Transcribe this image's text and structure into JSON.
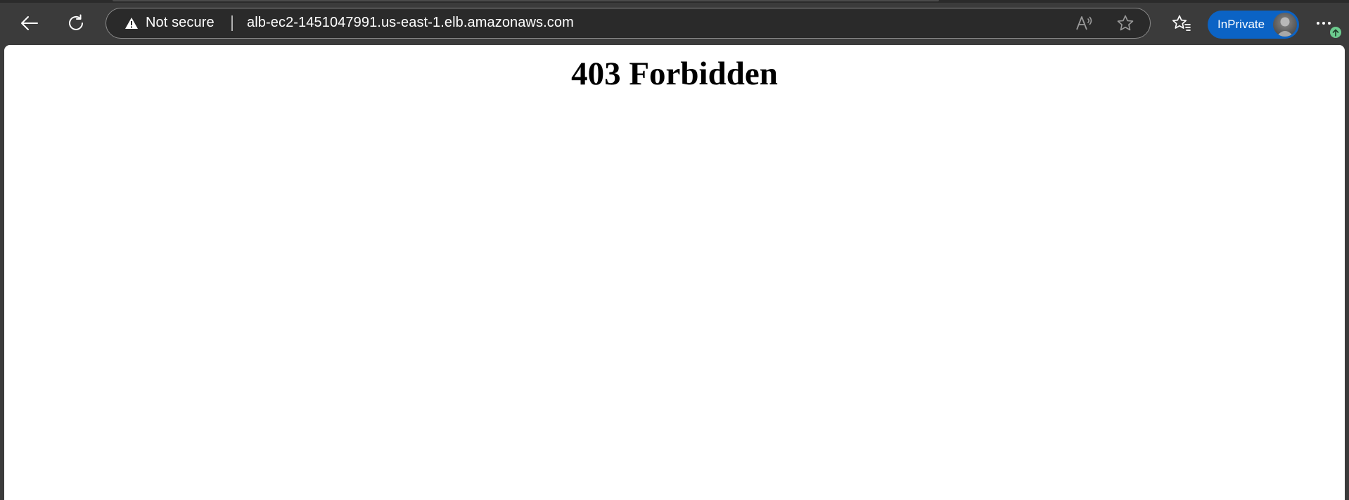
{
  "browser": {
    "address_bar": {
      "security_label": "Not secure",
      "url": "alb-ec2-1451047991.us-east-1.elb.amazonaws.com"
    },
    "profile": {
      "label": "InPrivate"
    },
    "icons": {
      "back": "back-arrow-icon",
      "refresh": "refresh-icon",
      "security": "warning-triangle-icon",
      "read_aloud": "read-aloud-icon",
      "favorite": "star-icon",
      "favorites": "favorites-icon",
      "avatar": "avatar-icon",
      "more": "more-icon",
      "update": "update-arrow-icon"
    },
    "colors": {
      "toolbar_bg": "#3b3b3b",
      "inprivate_bg": "#0b63c5",
      "update_badge": "#6ccb8e"
    }
  },
  "page": {
    "heading": "403 Forbidden"
  }
}
